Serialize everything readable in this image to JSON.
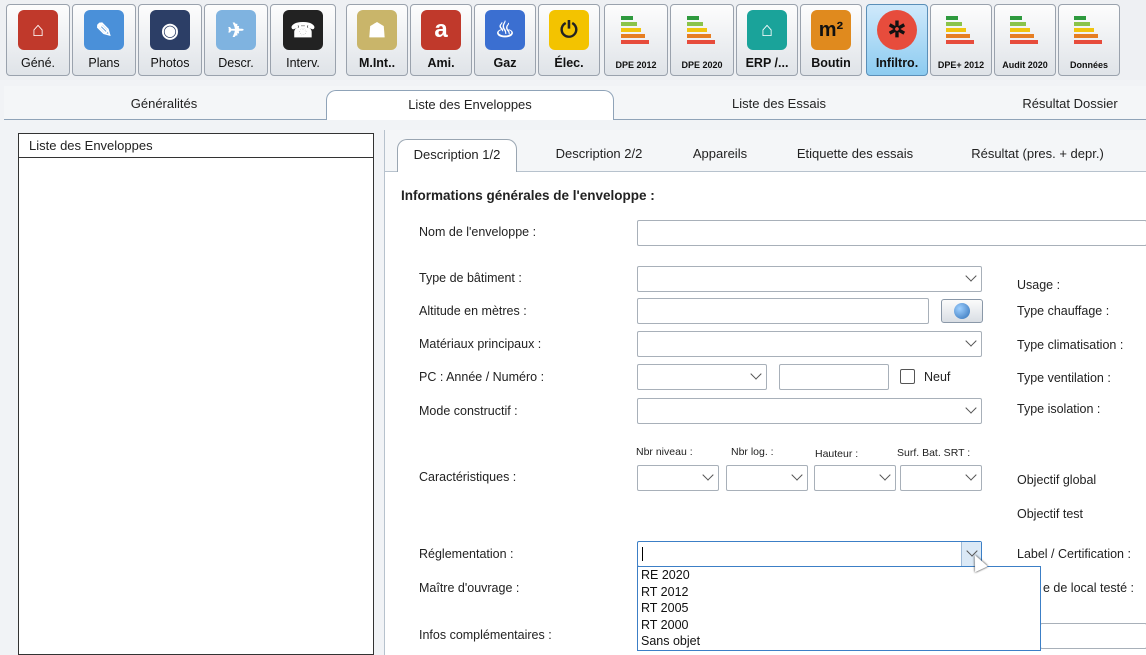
{
  "toolbar": {
    "buttons": [
      {
        "label": "Géné.",
        "icon": "house-icon"
      },
      {
        "label": "Plans",
        "icon": "ruler-pencil-icon"
      },
      {
        "label": "Photos",
        "icon": "camera-icon"
      },
      {
        "label": "Descr.",
        "icon": "paper-plane-icon"
      },
      {
        "label": "Interv.",
        "icon": "phone-icon"
      },
      {
        "label": "M.Int..",
        "icon": "person-door-icon"
      },
      {
        "label": "Ami.",
        "icon": "letter-a-icon",
        "glyph": "a"
      },
      {
        "label": "Gaz",
        "icon": "flame-icon"
      },
      {
        "label": "Élec.",
        "icon": "plug-icon"
      },
      {
        "label": "DPE 2012",
        "icon": "energy-label-icon"
      },
      {
        "label": "DPE 2020",
        "icon": "energy-label-eu-icon"
      },
      {
        "label": "ERP /...",
        "icon": "factory-icon"
      },
      {
        "label": "Boutin",
        "icon": "square-meter-icon",
        "glyph": "m²"
      },
      {
        "label": "Infiltro.",
        "icon": "fan-icon"
      },
      {
        "label": "DPE+ 2012",
        "icon": "energy-label-plus-icon"
      },
      {
        "label": "Audit 2020",
        "icon": "energy-label-plus-eu-icon"
      },
      {
        "label": "Données",
        "icon": "energy-label-data-icon"
      }
    ]
  },
  "main_tabs": [
    "Généralités",
    "Liste des Enveloppes",
    "Liste des Essais",
    "Résultat Dossier"
  ],
  "left_panel": {
    "title": "Liste des Enveloppes"
  },
  "sub_tabs": [
    "Description 1/2",
    "Description 2/2",
    "Appareils",
    "Etiquette des essais",
    "Résultat (pres. + depr.)"
  ],
  "form": {
    "section_title": "Informations générales de l'enveloppe :",
    "nom_label": "Nom de l'enveloppe :",
    "type_batiment_label": "Type de bâtiment :",
    "altitude_label": "Altitude en mètres :",
    "materiaux_label": "Matériaux principaux :",
    "pc_label": "PC : Année / Numéro :",
    "neuf_label": "Neuf",
    "mode_label": "Mode constructif :",
    "caracteristiques_label": "Caractéristiques :",
    "nbr_niveau_label": "Nbr niveau :",
    "nbr_log_label": "Nbr log. :",
    "hauteur_label": "Hauteur :",
    "surf_label": "Surf. Bat. SRT :",
    "reglementation_label": "Réglementation :",
    "maitre_label": "Maître d'ouvrage :",
    "infos_label": "Infos complémentaires :"
  },
  "right_labels": {
    "usage": "Usage :",
    "chauffage": "Type chauffage :",
    "climatisation": "Type climatisation :",
    "ventilation": "Type ventilation :",
    "isolation": "Type isolation :",
    "objectif_global": "Objectif global",
    "objectif_test": "Objectif test",
    "label_certification": "Label / Certification :",
    "local_teste": "e de local testé :"
  },
  "reglementation_options": [
    "RE 2020",
    "RT 2012",
    "RT 2005",
    "RT 2000",
    "Sans objet"
  ],
  "colors": {
    "active_tab_bg": "#ffffff",
    "focus_border": "#3c7fc6",
    "toolbar_active": "#8ccbf0"
  }
}
